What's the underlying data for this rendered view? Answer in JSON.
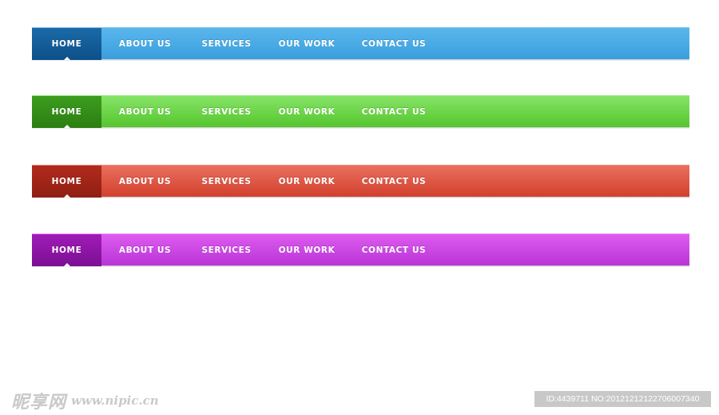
{
  "navbars": [
    {
      "theme": "blue",
      "colors": {
        "bar": "#4aa9e5",
        "active": "#0f5a92"
      },
      "items": [
        "HOME",
        "ABOUT US",
        "SERVICES",
        "OUR WORK",
        "CONTACT US"
      ],
      "active": "HOME"
    },
    {
      "theme": "green",
      "colors": {
        "bar": "#6ad446",
        "active": "#318a16"
      },
      "items": [
        "HOME",
        "ABOUT US",
        "SERVICES",
        "OUR WORK",
        "CONTACT US"
      ],
      "active": "HOME"
    },
    {
      "theme": "red",
      "colors": {
        "bar": "#de5544",
        "active": "#a02416"
      },
      "items": [
        "HOME",
        "ABOUT US",
        "SERVICES",
        "OUR WORK",
        "CONTACT US"
      ],
      "active": "HOME"
    },
    {
      "theme": "purple",
      "colors": {
        "bar": "#cc47e4",
        "active": "#8e15a6"
      },
      "items": [
        "HOME",
        "ABOUT US",
        "SERVICES",
        "OUR WORK",
        "CONTACT US"
      ],
      "active": "HOME"
    }
  ],
  "watermark": {
    "site_cn": "昵享网",
    "site_url": "www.nipic.cn",
    "id_text": "ID:4439711 NO:20121212122706007340"
  }
}
